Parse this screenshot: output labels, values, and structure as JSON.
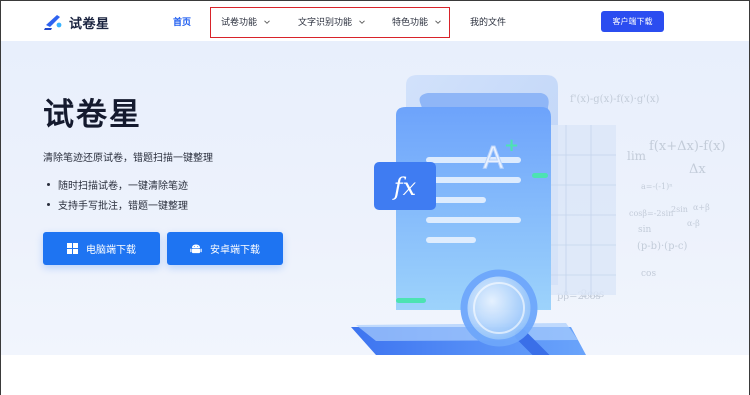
{
  "header": {
    "logo_text": "试卷星",
    "nav": {
      "home": "首页",
      "exam_features": "试卷功能",
      "ocr_features": "文字识别功能",
      "special_features": "特色功能",
      "my_files": "我的文件"
    },
    "client_download": "客户端下载",
    "accent_color": "#2b4df0",
    "highlight_color": "#d8232a"
  },
  "hero": {
    "title": "试卷星",
    "subtitle": "清除笔迹还原试卷，错题扫描一键整理",
    "bullets": [
      "随时扫描试卷，一键清除笔迹",
      "支持手写批注，错题一键整理"
    ],
    "buttons": {
      "pc_download": "电脑端下载",
      "android_download": "安卓端下载"
    },
    "illustration": {
      "badge_text": "fx",
      "grade_text": "A",
      "grade_sup": "+"
    },
    "math_background": [
      "f'(x)-g(x)-f(x)·g'(x)",
      "f(x+Δx)-f(x)",
      "lim",
      "Δx",
      "a=-(-1)ⁿ",
      "2sin",
      "cosβ=-2sin",
      "α+β",
      "(p-b)·(p-c)",
      "α-β",
      "sin",
      "2cos",
      "cos",
      "pβ=2cos"
    ]
  }
}
